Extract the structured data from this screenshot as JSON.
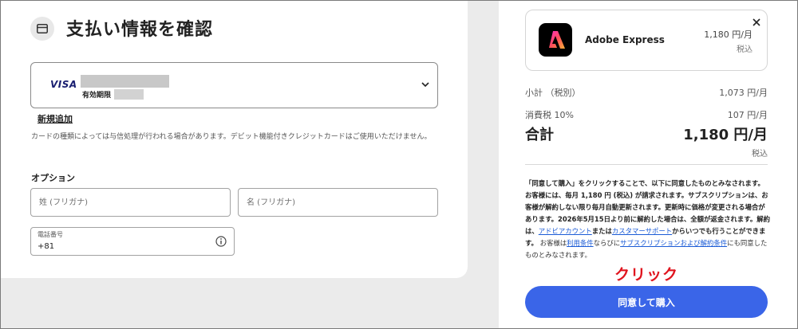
{
  "header": {
    "title": "支払い情報を確認",
    "icon": "card-icon"
  },
  "payment": {
    "brand": "VISA",
    "expiry_label": "有効期限",
    "add_new": "新規追加",
    "notice": "カードの種類によっては与信処理が行われる場合があります。デビット機能付きクレジットカードはご使用いただけません。"
  },
  "options": {
    "heading": "オプション",
    "last_name_placeholder": "姓 (フリガナ)",
    "first_name_placeholder": "名 (フリガナ)",
    "phone_label": "電話番号",
    "phone_value": "+81"
  },
  "product": {
    "name": "Adobe Express",
    "price": "1,180 円/月",
    "tax_note": "税込"
  },
  "summary": {
    "subtotal_label": "小計 （税別）",
    "subtotal_value": "1,073 円/月",
    "tax_label": "消費税 10%",
    "tax_value": "107 円/月",
    "total_label": "合計",
    "total_value": "1,180 円/月",
    "total_tax_note": "税込"
  },
  "legal": {
    "p1": "「同意して購入」をクリックすることで、以下に同意したものとみなされます。お客様には、毎月 1,180 円 (税込) が請求されます。サブスクリプションは、お客様が解約しない限り毎月自動更新されます。更新時に価格が変更される場合があります。2026年5月15日より前に解約した場合は、全額が返金されます。解約は、",
    "link_account": "アドビアカウント",
    "p2": "または",
    "link_support": "カスタマーサポート",
    "p3": "からいつでも行うことができます。",
    "p4": "お客様は",
    "link_terms": "利用条件",
    "p5": "ならびに",
    "link_subscription": "サブスクリプションおよび解約条件",
    "p6": "にも同意したものとみなされます。"
  },
  "annotation": {
    "click": "クリック"
  },
  "cta": {
    "label": "同意して購入"
  },
  "colors": {
    "accent": "#3a65e8",
    "annotation": "#e0141e",
    "link": "#1b5bd6"
  }
}
